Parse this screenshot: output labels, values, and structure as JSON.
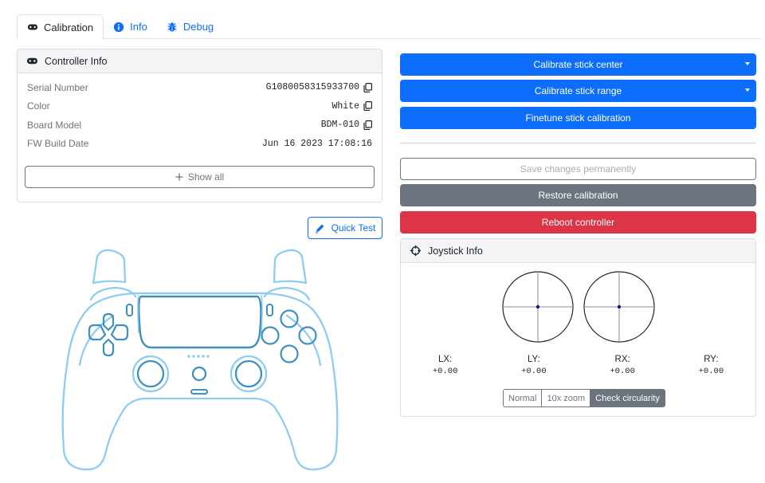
{
  "tabs": [
    {
      "label": "Calibration",
      "icon": "gamepad-icon",
      "active": true
    },
    {
      "label": "Info",
      "icon": "info-circle-icon",
      "active": false
    },
    {
      "label": "Debug",
      "icon": "bug-icon",
      "active": false
    }
  ],
  "controller_info": {
    "title": "Controller Info",
    "rows": [
      {
        "label": "Serial Number",
        "value": "G1080058315933700",
        "copyable": true
      },
      {
        "label": "Color",
        "value": "White",
        "copyable": true
      },
      {
        "label": "Board Model",
        "value": "BDM-010",
        "copyable": true
      },
      {
        "label": "FW Build Date",
        "value": "Jun 16 2023 17:08:16",
        "copyable": false
      }
    ],
    "show_all_label": "Show all"
  },
  "quick_test_label": "Quick Test",
  "actions": {
    "calibrate_center": "Calibrate stick center",
    "calibrate_range": "Calibrate stick range",
    "finetune": "Finetune stick calibration",
    "save": "Save changes permanently",
    "restore": "Restore calibration",
    "reboot": "Reboot controller"
  },
  "joystick_info": {
    "title": "Joystick Info",
    "axes": [
      {
        "name": "LX:",
        "value": "+0.00"
      },
      {
        "name": "LY:",
        "value": "+0.00"
      },
      {
        "name": "RX:",
        "value": "+0.00"
      },
      {
        "name": "RY:",
        "value": "+0.00"
      }
    ],
    "modes": [
      "Normal",
      "10x zoom",
      "Check circularity"
    ],
    "active_mode": "Check circularity"
  },
  "colors": {
    "primary": "#0d6efd",
    "secondary": "#6c757d",
    "danger": "#dc3545",
    "controller_outline": "#8fcdf0",
    "controller_buttons": "#3f8fbf"
  }
}
